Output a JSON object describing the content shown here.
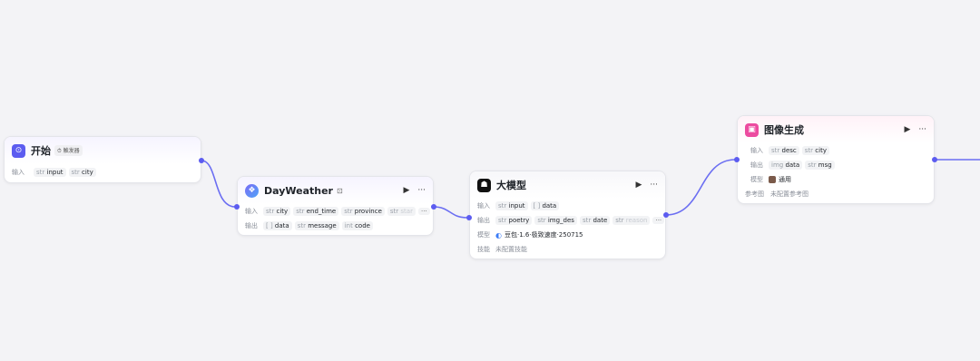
{
  "nodes": {
    "start": {
      "title": "开始",
      "tag": "⏱ 触发器",
      "input_label": "输入",
      "inputs": [
        {
          "type": "str",
          "name": "input"
        },
        {
          "type": "str",
          "name": "city"
        }
      ]
    },
    "dayweather": {
      "title": "DayWeather",
      "title_icon": "plugin-icon",
      "input_label": "输入",
      "output_label": "输出",
      "inputs": [
        {
          "type": "str",
          "name": "city"
        },
        {
          "type": "str",
          "name": "end_time"
        },
        {
          "type": "str",
          "name": "province"
        },
        {
          "type": "str",
          "name": "star"
        }
      ],
      "outputs": [
        {
          "type": "[ ]",
          "name": "data"
        },
        {
          "type": "str",
          "name": "message"
        },
        {
          "type": "int",
          "name": "code"
        }
      ],
      "more": "···"
    },
    "llm": {
      "title": "大模型",
      "input_label": "输入",
      "output_label": "输出",
      "model_label": "模型",
      "skill_label": "技能",
      "inputs": [
        {
          "type": "str",
          "name": "input"
        },
        {
          "type": "[ ]",
          "name": "data"
        }
      ],
      "outputs": [
        {
          "type": "str",
          "name": "poetry"
        },
        {
          "type": "str",
          "name": "img_des"
        },
        {
          "type": "str",
          "name": "date"
        },
        {
          "type": "str",
          "name": "reason"
        }
      ],
      "model": "豆包·1.6·极致速度·250715",
      "skill": "未配置技能",
      "more": "···"
    },
    "image": {
      "title": "图像生成",
      "input_label": "输入",
      "output_label": "输出",
      "model_label": "模型",
      "ref_label": "参考图",
      "inputs": [
        {
          "type": "str",
          "name": "desc"
        },
        {
          "type": "str",
          "name": "city"
        }
      ],
      "outputs": [
        {
          "type": "img",
          "name": "data"
        },
        {
          "type": "str",
          "name": "msg"
        }
      ],
      "model": "通用",
      "ref": "未配置参考图"
    }
  },
  "controls": {
    "run": "▶",
    "menu": "···"
  },
  "colors": {
    "accent": "#5c5cf0",
    "edge": "#6b6ef2"
  }
}
